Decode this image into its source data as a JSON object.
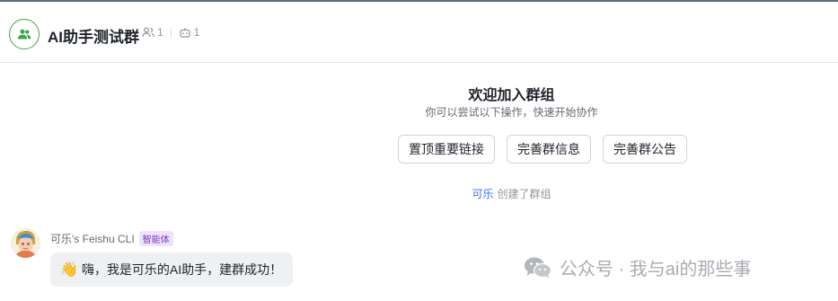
{
  "header": {
    "group_name": "AI助手测试群",
    "member_count": "1",
    "bot_count": "1"
  },
  "welcome": {
    "title": "欢迎加入群组",
    "subtitle": "你可以尝试以下操作，快速开始协作",
    "actions": [
      "置顶重要链接",
      "完善群信息",
      "完善群公告"
    ]
  },
  "system_message": {
    "user": "可乐",
    "text": "创建了群组"
  },
  "message": {
    "sender": "可乐's Feishu CLI",
    "badge": "智能体",
    "emoji": "👋",
    "text": "嗨，我是可乐的AI助手，建群成功！"
  },
  "watermark": {
    "text": "公众号 · 我与ai的那些事"
  },
  "colors": {
    "group_icon": "#3fa44a",
    "link": "#3370ff",
    "badge_bg": "#efe3fb",
    "badge_text": "#7a38c8"
  }
}
